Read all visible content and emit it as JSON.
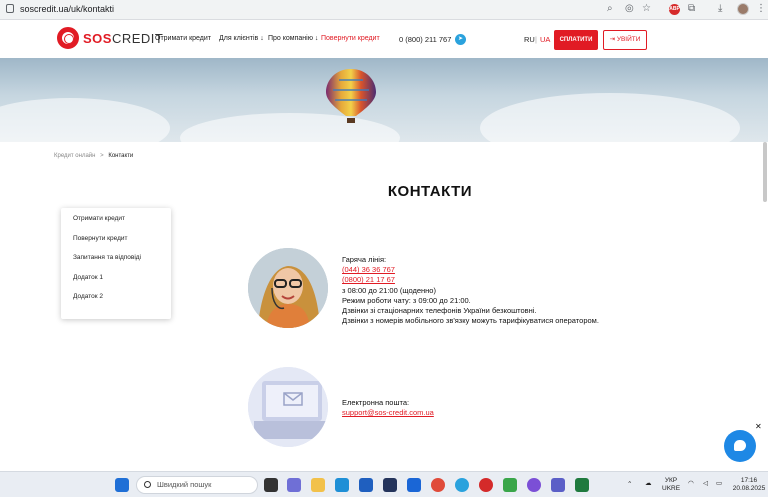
{
  "browser": {
    "url": "soscredit.ua/uk/kontakti"
  },
  "header": {
    "logo_sos": "SOS",
    "logo_credit": "CREDIT",
    "nav": [
      {
        "label": "Отримати кредит"
      },
      {
        "label": "Для клієнтів ↓"
      },
      {
        "label": "Про компанію ↓"
      },
      {
        "label": "Повернути кредит"
      }
    ],
    "phone": "0 (800) 211 767",
    "lang_ru": "RU",
    "lang_sep": "|",
    "lang_ua": "UA",
    "pay_label": "СПЛАТИТИ",
    "login_label": "УВІЙТИ"
  },
  "breadcrumb": {
    "home": "Кредит онлайн",
    "sep": ">",
    "current": "Контакти"
  },
  "page_title": "КОНТАКТИ",
  "side_menu": [
    {
      "label": "Отримати кредит"
    },
    {
      "label": "Повернути кредит"
    },
    {
      "label": "Запитання та відповіді"
    },
    {
      "label": "Додаток 1"
    },
    {
      "label": "Додаток 2"
    }
  ],
  "hotline": {
    "heading": "Гаряча лінія:",
    "phone1": "(044) 36 36 767",
    "phone2": "(0800) 21 17 67",
    "hours": "з 08:00 до 21:00 (щоденно)",
    "chat_hours": "Режим роботи чату: з 09:00 до 21:00.",
    "note1": "Дзвінки зі стаціонарних телефонів України безкоштовні.",
    "note2": "Дзвінки з номерів мобільного зв'язку можуть тарифікуватися оператором."
  },
  "email": {
    "heading": "Електронна пошта:",
    "address": "support@sos-credit.com.ua"
  },
  "taskbar": {
    "search_placeholder": "Швидкий пошук",
    "lang_top": "УКР",
    "lang_bottom": "UKRE",
    "time": "17:16",
    "date": "20.08.2025"
  },
  "colors": {
    "brand_red": "#e11b24",
    "chat_blue": "#1e88e5"
  }
}
